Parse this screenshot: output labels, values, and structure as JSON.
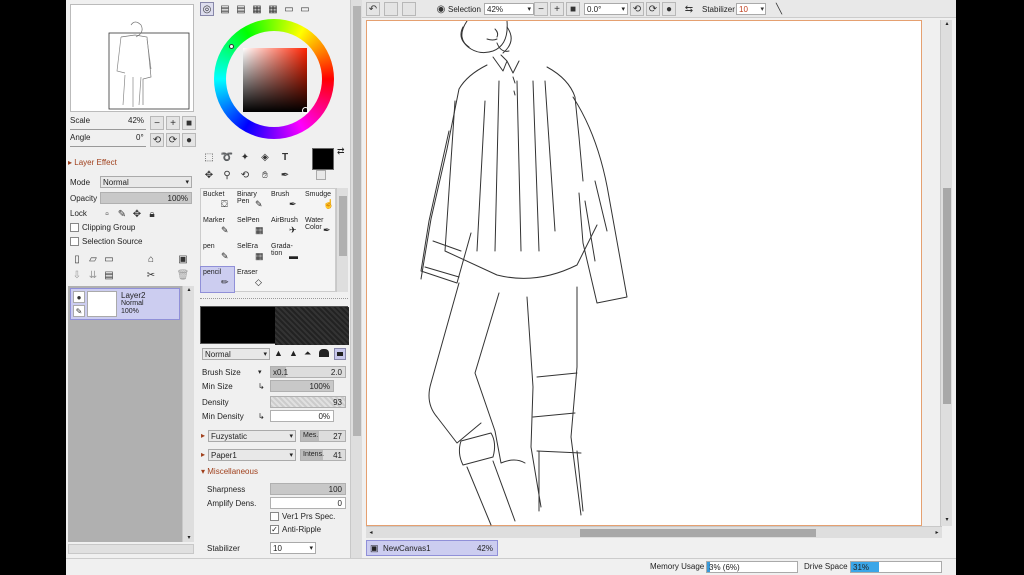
{
  "navigator": {
    "scale_label": "Scale",
    "scale_value": "42%",
    "angle_label": "Angle",
    "angle_value": "0°"
  },
  "layer_panel": {
    "section_title": "Layer Effect",
    "mode_label": "Mode",
    "mode_value": "Normal",
    "opacity_label": "Opacity",
    "opacity_value": "100%",
    "lock_label": "Lock",
    "clipping_group": "Clipping Group",
    "selection_source": "Selection Source",
    "layer": {
      "name": "Layer2",
      "mode": "Normal",
      "opacity": "100%"
    }
  },
  "color": {
    "primary": "#000000",
    "secondary": "#ffffff",
    "accent": "#7b1b0c"
  },
  "tools": [
    {
      "label": "Bucket",
      "icon": "bucket-icon"
    },
    {
      "label": "Binary Pen",
      "icon": "pen-icon"
    },
    {
      "label": "Brush",
      "icon": "brush-icon"
    },
    {
      "label": "Smudge",
      "icon": "smudge-icon"
    },
    {
      "label": "Marker",
      "icon": "marker-icon"
    },
    {
      "label": "SelPen",
      "icon": "selpen-icon"
    },
    {
      "label": "AirBrush",
      "icon": "airbrush-icon"
    },
    {
      "label": "Water Color",
      "icon": "watercolor-icon"
    },
    {
      "label": "pen",
      "icon": "pen-icon"
    },
    {
      "label": "SelEra",
      "icon": "selera-icon"
    },
    {
      "label": "Grada-tion",
      "icon": "gradation-icon"
    },
    {
      "label": "",
      "icon": ""
    },
    {
      "label": "pencil",
      "icon": "pencil-icon",
      "selected": true
    },
    {
      "label": "Eraser",
      "icon": "eraser-icon"
    },
    {
      "label": "",
      "icon": ""
    },
    {
      "label": "",
      "icon": ""
    }
  ],
  "brush": {
    "blend_mode": "Normal",
    "brush_size_label": "Brush Size",
    "brush_size_mult": "x0.1",
    "brush_size_value": "2.0",
    "min_size_label": "Min Size",
    "min_size_value": "100%",
    "density_label": "Density",
    "density_value": "93",
    "min_density_label": "Min Density",
    "min_density_value": "0%",
    "texture1_name": "Fuzystatic",
    "texture1_param_label": "Mes.",
    "texture1_param_value": "27",
    "texture2_name": "Paper1",
    "texture2_param_label": "Intens.",
    "texture2_param_value": "41",
    "misc_title": "Miscellaneous",
    "sharpness_label": "Sharpness",
    "sharpness_value": "100",
    "amplify_label": "Amplify Dens.",
    "amplify_value": "0",
    "ver1_label": "Ver1 Prs Spec.",
    "anti_ripple_label": "Anti-Ripple",
    "stabilizer_label": "Stabilizer",
    "stabilizer_value": "10"
  },
  "toolbar": {
    "selection_label": "Selection",
    "zoom_value": "42%",
    "rotation_value": "0.0°",
    "stabilizer_label": "Stabilizer",
    "stabilizer_value": "10"
  },
  "canvas_tab": {
    "name": "NewCanvas1",
    "zoom": "42%"
  },
  "status_bar": {
    "memory_label": "Memory Usage",
    "memory_value": "3% (6%)",
    "memory_fraction": 0.03,
    "drive_label": "Drive Space",
    "drive_value": "31%",
    "drive_fraction": 0.31
  }
}
